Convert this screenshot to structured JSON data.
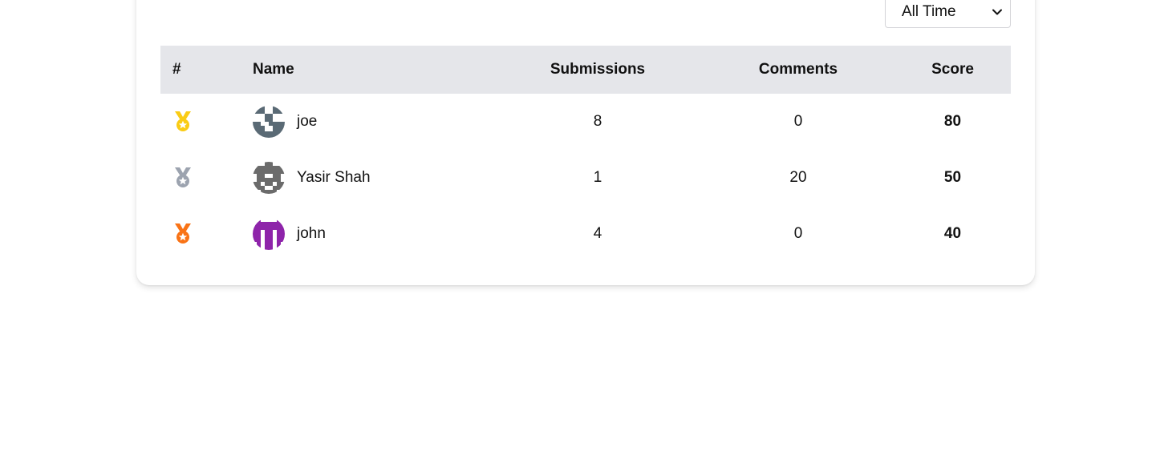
{
  "filter": {
    "selected": "All Time"
  },
  "table": {
    "headers": {
      "rank": "#",
      "name": "Name",
      "submissions": "Submissions",
      "comments": "Comments",
      "score": "Score"
    },
    "rows": [
      {
        "medal": "gold-medal-icon",
        "medal_color": "#facc15",
        "name": "joe",
        "avatar_color": "#5a6a75",
        "submissions": "8",
        "comments": "0",
        "score": "80"
      },
      {
        "medal": "silver-medal-icon",
        "medal_color": "#9ca3af",
        "name": "Yasir Shah",
        "avatar_color": "#6b6b6b",
        "submissions": "1",
        "comments": "20",
        "score": "50"
      },
      {
        "medal": "bronze-medal-icon",
        "medal_color": "#f97316",
        "name": "john",
        "avatar_color": "#8e24aa",
        "submissions": "4",
        "comments": "0",
        "score": "40"
      }
    ]
  }
}
